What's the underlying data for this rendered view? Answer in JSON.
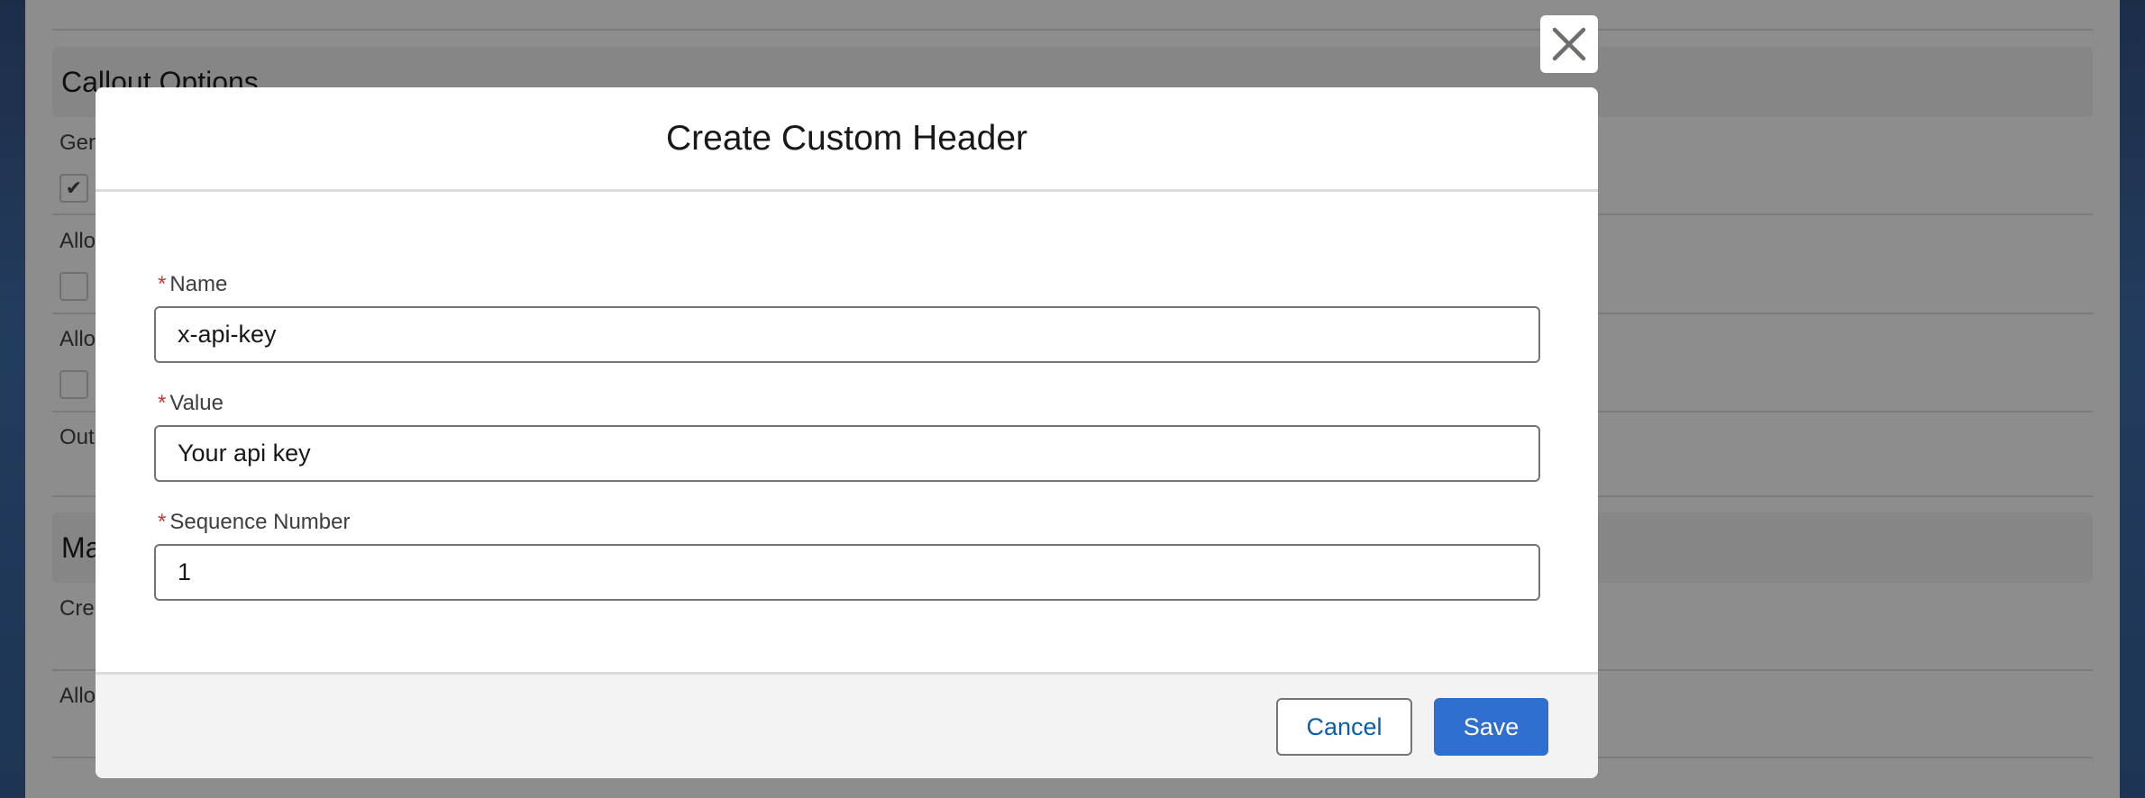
{
  "background": {
    "sections": [
      "Callout Options",
      "Ma"
    ],
    "labels": [
      "Gen",
      "Allo",
      "Allo",
      "Out",
      "Cre",
      "Allo"
    ]
  },
  "modal": {
    "title": "Create Custom Header",
    "required_mark": "*",
    "fields": [
      {
        "label": "Name",
        "value": "x-api-key"
      },
      {
        "label": "Value",
        "value": "Your api key"
      },
      {
        "label": "Sequence Number",
        "value": "1"
      }
    ],
    "cancel_label": "Cancel",
    "save_label": "Save"
  },
  "colors": {
    "brand_button": "#2f6fd0",
    "link_text": "#0b5cab",
    "required": "#c23934"
  },
  "icons": {
    "close": "close-icon",
    "checkbox_check": "check-icon"
  }
}
